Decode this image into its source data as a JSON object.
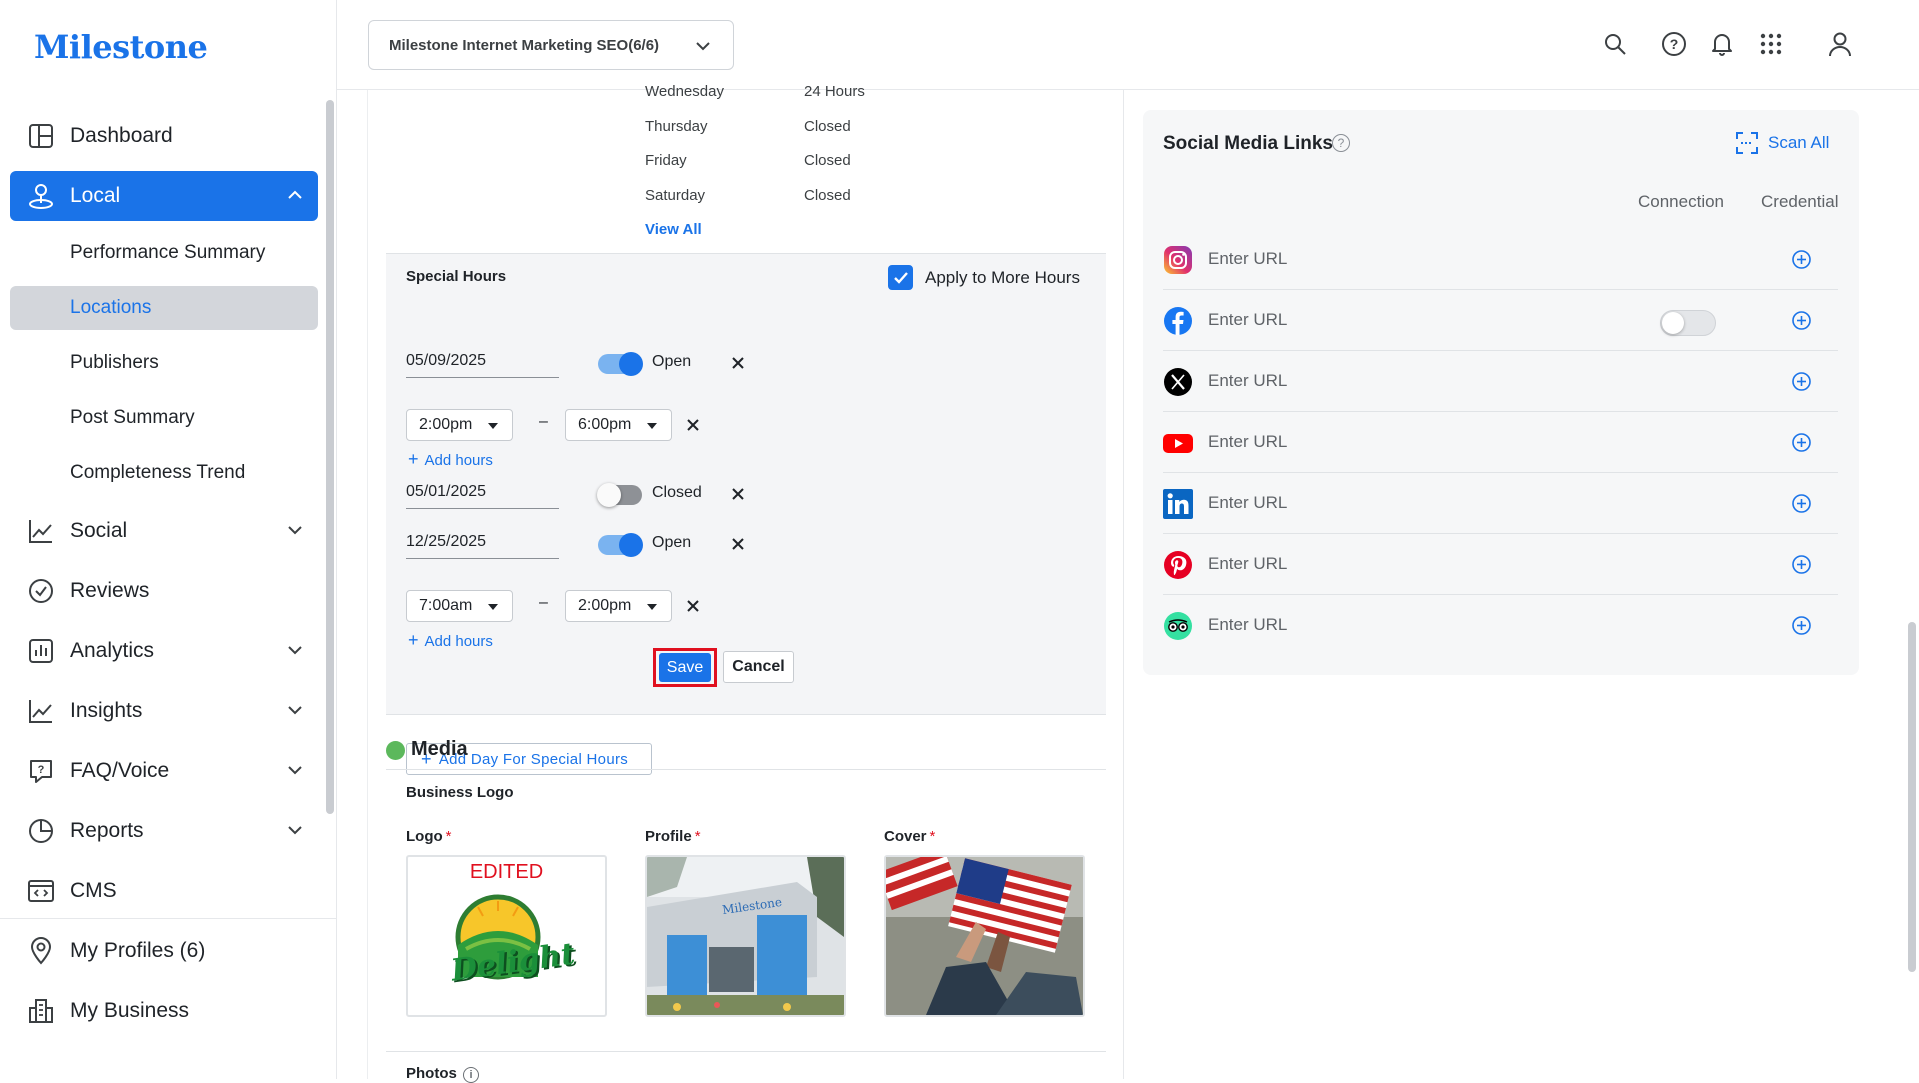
{
  "brand": {
    "logo_text": "Milestone",
    "accent": "#1a73e8",
    "danger": "#e0101f"
  },
  "header": {
    "org_selector": "Milestone Internet Marketing SEO(6/6)",
    "icons": [
      "search-icon",
      "help-icon",
      "bell-icon",
      "apps-grid-icon",
      "user-icon"
    ]
  },
  "sidebar": {
    "dashboard": "Dashboard",
    "local": "Local",
    "local_sub": {
      "performance_summary": "Performance Summary",
      "locations": "Locations",
      "publishers": "Publishers",
      "post_summary": "Post Summary",
      "completeness_trend": "Completeness Trend"
    },
    "social": "Social",
    "reviews": "Reviews",
    "analytics": "Analytics",
    "insights": "Insights",
    "faq_voice": "FAQ/Voice",
    "reports": "Reports",
    "cms": "CMS",
    "my_profiles": "My Profiles (6)",
    "my_business": "My Business"
  },
  "hours": {
    "rows": [
      {
        "day": "Wednesday",
        "value": "24 Hours"
      },
      {
        "day": "Thursday",
        "value": "Closed"
      },
      {
        "day": "Friday",
        "value": "Closed"
      },
      {
        "day": "Saturday",
        "value": "Closed"
      }
    ],
    "view_all": "View All"
  },
  "special_hours": {
    "title": "Special Hours",
    "apply_label": "Apply to More Hours",
    "apply_checked": true,
    "entries": [
      {
        "date": "05/09/2025",
        "state": "Open",
        "open": true,
        "start": "2:00pm",
        "end": "6:00pm"
      },
      {
        "date": "05/01/2025",
        "state": "Closed",
        "open": false
      },
      {
        "date": "12/25/2025",
        "state": "Open",
        "open": true,
        "start": "7:00am",
        "end": "2:00pm"
      }
    ],
    "add_hours": "Add hours",
    "dash": "–",
    "add_day": "Add Day For Special Hours",
    "save": "Save",
    "cancel": "Cancel"
  },
  "media": {
    "title": "Media",
    "business_logo": "Business Logo",
    "logo_label": "Logo",
    "profile_label": "Profile",
    "cover_label": "Cover",
    "required_mark": "*",
    "logo_caption": "EDITED",
    "logo_word": "Delight",
    "building_sign": "Milestone",
    "photos_title": "Photos",
    "photos_info": "i"
  },
  "social": {
    "title": "Social Media Links",
    "help": "?",
    "scan_all": "Scan All",
    "col_connection": "Connection",
    "col_credential": "Credential",
    "rows": [
      {
        "network": "instagram",
        "icon": "instagram-icon",
        "placeholder": "Enter URL",
        "has_toggle": false
      },
      {
        "network": "facebook",
        "icon": "facebook-icon",
        "placeholder": "Enter URL",
        "has_toggle": true
      },
      {
        "network": "x",
        "icon": "x-icon",
        "placeholder": "Enter URL",
        "has_toggle": false
      },
      {
        "network": "youtube",
        "icon": "youtube-icon",
        "placeholder": "Enter URL",
        "has_toggle": false
      },
      {
        "network": "linkedin",
        "icon": "linkedin-icon",
        "placeholder": "Enter URL",
        "has_toggle": false
      },
      {
        "network": "pinterest",
        "icon": "pinterest-icon",
        "placeholder": "Enter URL",
        "has_toggle": false
      },
      {
        "network": "tripadvisor",
        "icon": "tripadvisor-icon",
        "placeholder": "Enter URL",
        "has_toggle": false
      }
    ]
  }
}
